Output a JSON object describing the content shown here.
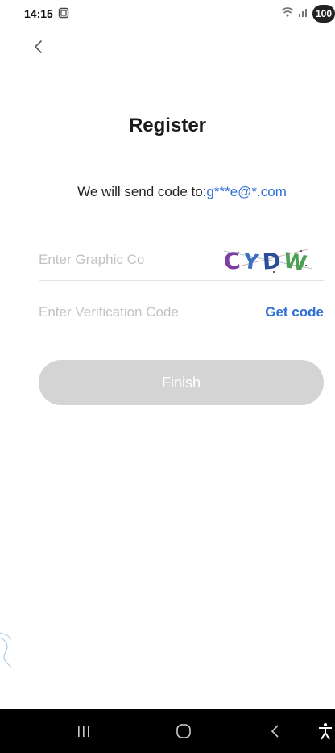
{
  "status_bar": {
    "time": "14:15",
    "battery": "100"
  },
  "page": {
    "title": "Register",
    "send_prefix": "We will send code to:",
    "email": "g***e@*.com"
  },
  "graphic_code": {
    "placeholder": "Enter Graphic Co",
    "value": "",
    "captcha_text": "CYDW"
  },
  "verification_code": {
    "placeholder": "Enter Verification Code",
    "value": "",
    "get_code_label": "Get code"
  },
  "finish_label": "Finish",
  "colors": {
    "accent": "#2f6fd6",
    "button_disabled": "#d4d4d4",
    "nav_bar": "#000000"
  }
}
